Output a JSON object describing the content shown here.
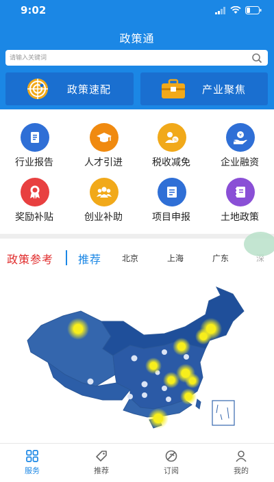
{
  "status_bar": {
    "time": "9:02"
  },
  "header": {
    "title": "政策通",
    "search": {
      "placeholder": "请输入关键词"
    },
    "buttons": [
      {
        "label": "政策速配",
        "icon": "radar-target-icon"
      },
      {
        "label": "产业聚焦",
        "icon": "toolbox-icon"
      }
    ]
  },
  "grid": [
    {
      "label": "行业报告",
      "icon": "report-doc-icon",
      "color": "#2f6fd6"
    },
    {
      "label": "人才引进",
      "icon": "graduation-cap-icon",
      "color": "#f08a10"
    },
    {
      "label": "税收减免",
      "icon": "people-discount-icon",
      "color": "#f1a91a"
    },
    {
      "label": "企业融资",
      "icon": "hand-coin-icon",
      "color": "#2f6fd6"
    },
    {
      "label": "奖励补贴",
      "icon": "award-medal-icon",
      "color": "#e84040"
    },
    {
      "label": "创业补助",
      "icon": "group-people-icon",
      "color": "#f1a91a"
    },
    {
      "label": "项目申报",
      "icon": "form-document-icon",
      "color": "#2f6fd6"
    },
    {
      "label": "土地政策",
      "icon": "book-notebook-icon",
      "color": "#8a4fd6"
    }
  ],
  "tabs": {
    "main": "政策参考",
    "recommend": "推荐",
    "cities": [
      "北京",
      "上海",
      "广东",
      "深"
    ]
  },
  "tabbar": [
    {
      "label": "服务",
      "icon": "grid-four-icon",
      "active": true
    },
    {
      "label": "推荐",
      "icon": "tag-icon",
      "active": false
    },
    {
      "label": "订阅",
      "icon": "subscribe-leaf-icon",
      "active": false
    },
    {
      "label": "我的",
      "icon": "user-profile-icon",
      "active": false
    }
  ],
  "colors": {
    "primary": "#1b87e5",
    "button_dark": "#1a6fd0",
    "accent_red": "#e02a2a"
  }
}
